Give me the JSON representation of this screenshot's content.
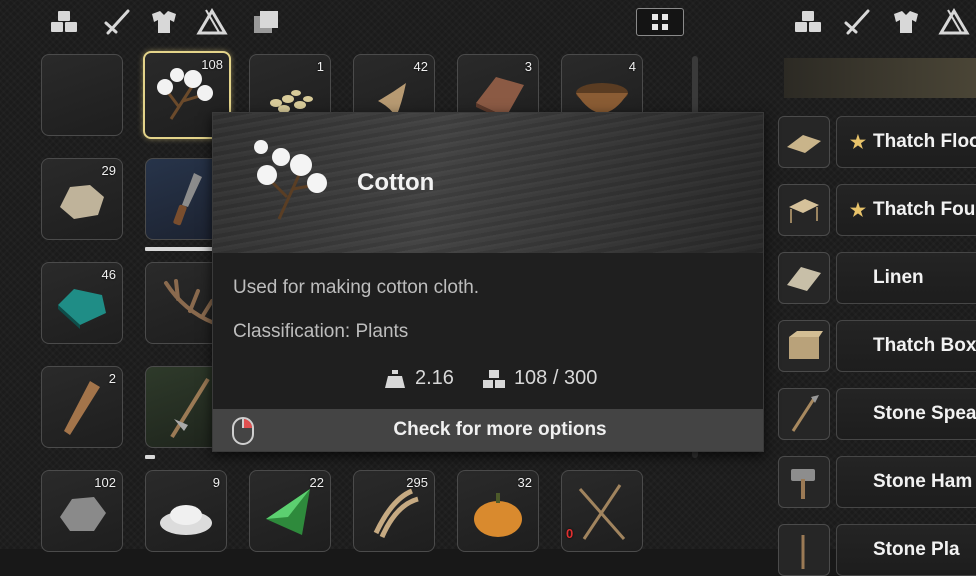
{
  "topbar": {
    "left_tabs": [
      "materials-icon",
      "weapons-icon",
      "armor-icon",
      "camp-icon",
      "layers-icon"
    ],
    "right_tabs": [
      "materials-icon",
      "weapons-icon",
      "armor-icon",
      "camp-icon"
    ],
    "toggle_icon": "grid-toggle-icon"
  },
  "inventory": {
    "rows": [
      [
        {
          "item": "empty",
          "qty": ""
        },
        {
          "item": "cotton",
          "qty": "108",
          "selected": true
        },
        {
          "item": "seeds",
          "qty": "1"
        },
        {
          "item": "tooth",
          "qty": "42"
        },
        {
          "item": "wood-plank",
          "qty": "3"
        },
        {
          "item": "wooden-bowl",
          "qty": "4"
        }
      ],
      [
        {
          "item": "stone-chunk",
          "qty": "29"
        },
        {
          "item": "stone-knife",
          "qty": "",
          "durability": 0.82
        }
      ],
      [
        {
          "item": "malachite-ore",
          "qty": "46"
        },
        {
          "item": "antler",
          "qty": ""
        }
      ],
      [
        {
          "item": "wooden-club",
          "qty": "2"
        },
        {
          "item": "spear-weapon",
          "qty": "",
          "durability": 0.12
        }
      ],
      [
        {
          "item": "iron-ore",
          "qty": "102"
        },
        {
          "item": "salt",
          "qty": "9"
        },
        {
          "item": "green-crystal",
          "qty": "22"
        },
        {
          "item": "fiber-rope",
          "qty": "295"
        },
        {
          "item": "pumpkin",
          "qty": "32"
        },
        {
          "item": "spears-bundle",
          "qty": "0"
        }
      ]
    ]
  },
  "tooltip": {
    "title": "Cotton",
    "description": "Used for making cotton cloth.",
    "classification": "Classification: Plants",
    "weight": "2.16",
    "stack": "108 / 300",
    "footer": "Check for more options"
  },
  "crafting": {
    "items": [
      {
        "label": "Thatch Floo",
        "favorite": true,
        "icon": "thatch-floor-icon"
      },
      {
        "label": "Thatch Fou",
        "favorite": true,
        "icon": "thatch-foundation-icon"
      },
      {
        "label": "Linen",
        "favorite": false,
        "icon": "linen-icon"
      },
      {
        "label": "Thatch Box",
        "favorite": false,
        "icon": "thatch-box-icon"
      },
      {
        "label": "Stone Spea",
        "favorite": false,
        "icon": "stone-spear-icon"
      },
      {
        "label": "Stone Ham",
        "favorite": false,
        "icon": "stone-hammer-icon"
      },
      {
        "label": "Stone Pla",
        "favorite": false,
        "icon": "stone-pickaxe-icon"
      }
    ]
  },
  "colors": {
    "accent": "#e4d48a",
    "favorite_star": "#e8c36a",
    "zero_qty": "#e03030"
  }
}
